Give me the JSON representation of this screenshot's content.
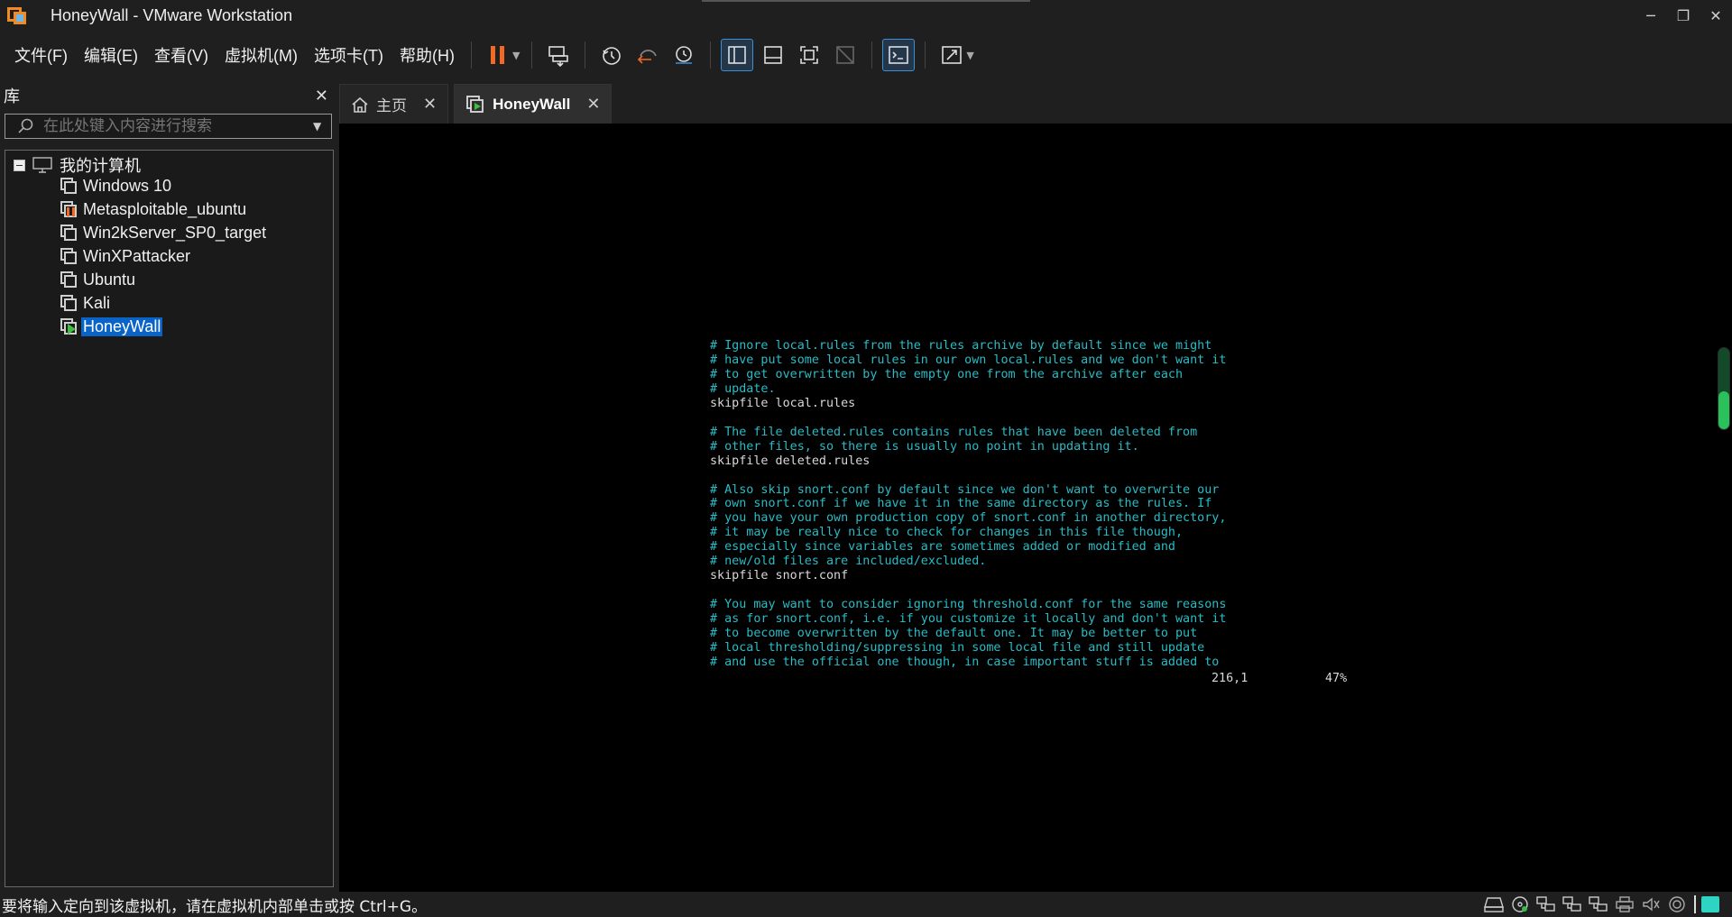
{
  "window": {
    "title": "HoneyWall - VMware Workstation",
    "controls": [
      "─",
      "❐",
      "✕"
    ]
  },
  "menu": [
    "文件(F)",
    "编辑(E)",
    "查看(V)",
    "虚拟机(M)",
    "选项卡(T)",
    "帮助(H)"
  ],
  "toolbar": {
    "icons": [
      "pause-icon",
      "send-ctrl-alt-del-icon",
      "snapshot-icon",
      "revert-snapshot-icon",
      "snapshot-manager-icon",
      "show-library-icon",
      "thumbnail-bar-icon",
      "full-screen-icon",
      "unity-icon",
      "console-view-icon",
      "stretch-guest-icon"
    ],
    "accent_color": "#f06a24"
  },
  "library": {
    "title": "库",
    "close": "✕",
    "search_placeholder": "在此处键入内容进行搜索",
    "root_label": "我的计算机",
    "vms": [
      {
        "name": "Windows 10",
        "state": "off"
      },
      {
        "name": "Metasploitable_ubuntu",
        "state": "paused"
      },
      {
        "name": "Win2kServer_SP0_target",
        "state": "off"
      },
      {
        "name": "WinXPattacker",
        "state": "off"
      },
      {
        "name": "Ubuntu",
        "state": "off"
      },
      {
        "name": "Kali",
        "state": "off"
      },
      {
        "name": "HoneyWall",
        "state": "running",
        "selected": true
      }
    ]
  },
  "tabs": [
    {
      "label": "主页",
      "icon": "home-icon",
      "active": false
    },
    {
      "label": "HoneyWall",
      "icon": "vm-running-icon",
      "active": true
    }
  ],
  "console": {
    "lines": [
      {
        "text": "# Ignore local.rules from the rules archive by default since we might",
        "kind": "comment"
      },
      {
        "text": "# have put some local rules in our own local.rules and we don't want it",
        "kind": "comment"
      },
      {
        "text": "# to get overwritten by the empty one from the archive after each",
        "kind": "comment"
      },
      {
        "text": "# update.",
        "kind": "comment"
      },
      {
        "text": "skipfile local.rules",
        "kind": "code"
      },
      {
        "text": "",
        "kind": "blank"
      },
      {
        "text": "# The file deleted.rules contains rules that have been deleted from",
        "kind": "comment"
      },
      {
        "text": "# other files, so there is usually no point in updating it.",
        "kind": "comment"
      },
      {
        "text": "skipfile deleted.rules",
        "kind": "code"
      },
      {
        "text": "",
        "kind": "blank"
      },
      {
        "text": "# Also skip snort.conf by default since we don't want to overwrite our",
        "kind": "comment"
      },
      {
        "text": "# own snort.conf if we have it in the same directory as the rules. If",
        "kind": "comment"
      },
      {
        "text": "# you have your own production copy of snort.conf in another directory,",
        "kind": "comment"
      },
      {
        "text": "# it may be really nice to check for changes in this file though,",
        "kind": "comment"
      },
      {
        "text": "# especially since variables are sometimes added or modified and",
        "kind": "comment"
      },
      {
        "text": "# new/old files are included/excluded.",
        "kind": "comment"
      },
      {
        "text": "skipfile snort.conf",
        "kind": "code"
      },
      {
        "text": "",
        "kind": "blank"
      },
      {
        "text": "# You may want to consider ignoring threshold.conf for the same reasons",
        "kind": "comment"
      },
      {
        "text": "# as for snort.conf, i.e. if you customize it locally and don't want it",
        "kind": "comment"
      },
      {
        "text": "# to become overwritten by the default one. It may be better to put",
        "kind": "comment"
      },
      {
        "text": "# local thresholding/suppressing in some local file and still update",
        "kind": "comment"
      },
      {
        "text": "# and use the official one though, in case important stuff is added to",
        "kind": "comment"
      }
    ],
    "cursor_position": "216,1",
    "percent": "47%",
    "comment_color": "#29bcc6",
    "code_color": "#d8d8d8",
    "scroll_fraction": 0.47
  },
  "status": {
    "message": "要将输入定向到该虚拟机，请在虚拟机内部单击或按 Ctrl+G。",
    "icons": [
      "hard-disk-icon",
      "cd-dvd-icon",
      "network-adapter-icon",
      "network-adapter-2-icon",
      "network-adapter-3-icon",
      "printer-icon",
      "sound-icon",
      "display-icon",
      "notes-icon"
    ]
  }
}
